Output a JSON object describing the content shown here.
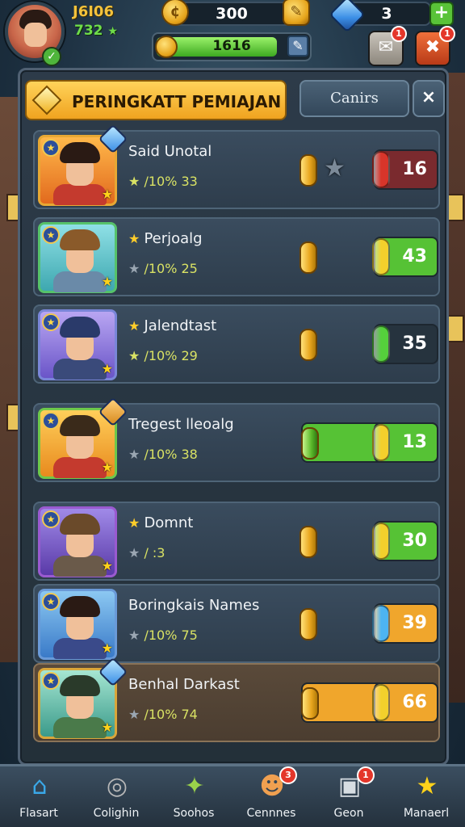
{
  "header": {
    "player_id": "J6I06",
    "player_score": "732",
    "coins": "300",
    "gems": "3",
    "xp_value": "1616",
    "xp_progress": 0.8,
    "plus_label": "+",
    "mail_badge": "1",
    "close_badge": "1"
  },
  "panel": {
    "title": "PERINGKATT PEMIAJAN",
    "tab_label": "Canirs",
    "close_label": "×"
  },
  "rows": [
    {
      "name": "Said Unotal",
      "stat": "/10% 33",
      "score": "16",
      "score_color": "#d8352a",
      "box_color": "#7a2a2e",
      "name_star": false
    },
    {
      "name": "Perjoalg",
      "stat": "/10% 25",
      "score": "43",
      "score_color": "#f3d02c",
      "box_color": "#56c235",
      "name_star": true
    },
    {
      "name": "Jalendtast",
      "stat": "/10% 29",
      "score": "35",
      "score_color": "#55d03c",
      "box_color": "#26333e",
      "name_star": true
    },
    {
      "name": "Tregest lleoalg",
      "stat": "/10% 38",
      "score": "13",
      "score_color": "#f3d02c",
      "box_color": "#56c235",
      "name_star": false
    },
    {
      "name": "Domnt",
      "stat": "/    :3",
      "score": "30",
      "score_color": "#f3d02c",
      "box_color": "#56c235",
      "name_star": true
    },
    {
      "name": "Boringkais Names",
      "stat": "/10% 75",
      "score": "39",
      "score_color": "#4db4f2",
      "box_color": "#f0a62c",
      "name_star": false
    },
    {
      "name": "Benhal Darkast",
      "stat": "/10% 74",
      "score": "66",
      "score_color": "#f3d02c",
      "box_color": "#f0a62c",
      "name_star": false
    }
  ],
  "nav": [
    {
      "label": "Flasart",
      "icon": "home-icon",
      "glyph": "⌂",
      "color": "#3aa8e8"
    },
    {
      "label": "Colighin",
      "icon": "search-icon",
      "glyph": "◎",
      "color": "#b8b8b8"
    },
    {
      "label": "Soohos",
      "icon": "tools-icon",
      "glyph": "✦",
      "color": "#9ad24a"
    },
    {
      "label": "Cennnes",
      "icon": "character-icon",
      "glyph": "☻",
      "color": "#f0a050",
      "badge": "3"
    },
    {
      "label": "Geon",
      "icon": "device-icon",
      "glyph": "▣",
      "color": "#d7dde2",
      "badge": "1"
    },
    {
      "label": "Manaerl",
      "icon": "star-icon",
      "glyph": "★",
      "color": "#ffd21a"
    }
  ]
}
